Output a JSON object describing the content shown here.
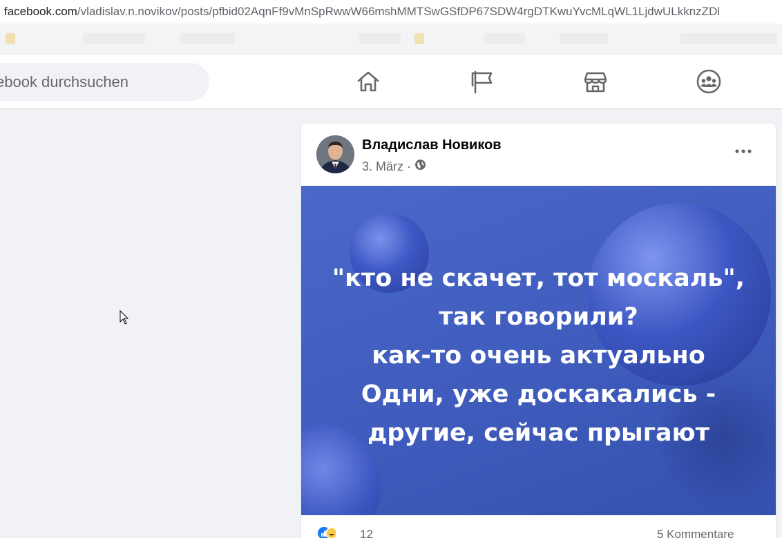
{
  "browser": {
    "url_host": "facebook.com",
    "url_path": "/vladislav.n.novikov/posts/pfbid02AqnFf9vMnSpRwwW66mshMMTSwGSfDP67SDW4rgDTKwuYvcMLqWL1LjdwULkknzZDl"
  },
  "navbar": {
    "search_placeholder": "ebook durchsuchen",
    "icons": [
      "home-icon",
      "pages-flag-icon",
      "marketplace-icon",
      "groups-icon"
    ],
    "active_color": "#050505"
  },
  "post": {
    "author": "Владислав Новиков",
    "date": "3. März",
    "separator": "·",
    "privacy_icon": "globe-icon",
    "image_lines": [
      "\"кто не скачет, тот москаль\",",
      "так говорили?",
      "как-то очень актуально",
      "Одни, уже доскакались -",
      "другие, сейчас прыгают"
    ],
    "image_bg_color": "#4462c6",
    "reactions_count": "12",
    "comments": "5 Kommentare"
  }
}
